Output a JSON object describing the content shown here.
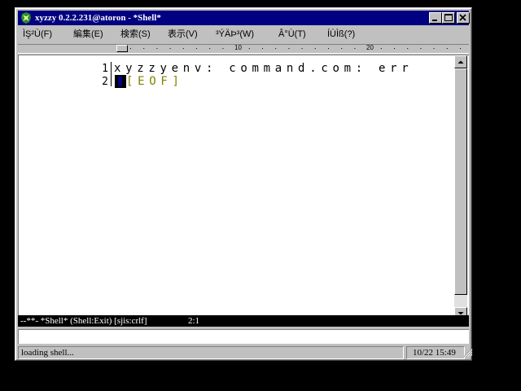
{
  "window": {
    "title": "xyzzy 0.2.2.231@atoron - *Shell*"
  },
  "menu": {
    "items": [
      {
        "label": "ÌŞ²Ù(F)"
      },
      {
        "label": "編集(E)"
      },
      {
        "label": "検索(S)"
      },
      {
        "label": "表示(V)"
      },
      {
        "label": "³ÝÄÞ³(W)"
      },
      {
        "label": "Â°Ù(T)"
      },
      {
        "label": "ÍÙÌß(?)"
      }
    ]
  },
  "ruler": {
    "marks": [
      "10",
      "20"
    ]
  },
  "editor": {
    "lines": [
      {
        "number": "1",
        "text": "xyzzyenv: command.com: err"
      },
      {
        "number": "2",
        "text": "[EOF]"
      }
    ]
  },
  "modeline": {
    "info": "--**- *Shell* (Shell:Exit) [sjis:crlf]",
    "position": "2:1"
  },
  "minibuffer": {
    "value": ""
  },
  "statusbar": {
    "message": "loading shell...",
    "datetime": "10/22 15:49"
  },
  "icons": {
    "app": "xyzzy-app-icon",
    "minimize": "minimize-icon",
    "maximize": "maximize-icon",
    "close": "close-icon",
    "scroll_up": "arrow-up-icon",
    "scroll_down": "arrow-down-icon",
    "grip": "size-grip-icon"
  },
  "colors": {
    "titlebar": "#000080",
    "eof_marker": "#808000",
    "modeline_bg": "#000000",
    "desktop": "#000000"
  }
}
